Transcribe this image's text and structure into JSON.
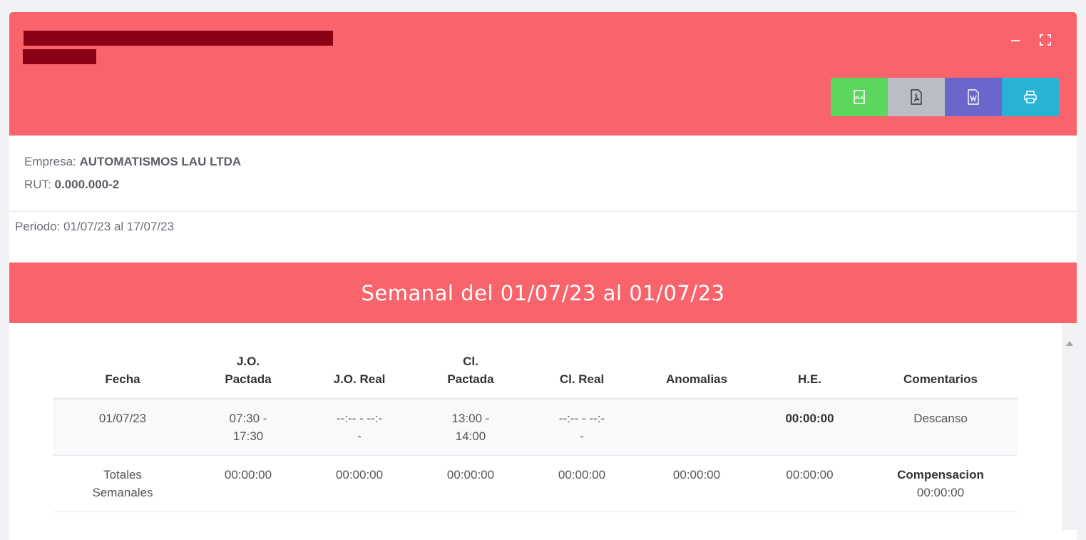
{
  "header": {
    "actions": {
      "xls_label": "XLS"
    },
    "colors": {
      "header_bg": "#f9636b",
      "redaction": "#8a0014"
    }
  },
  "info": {
    "empresa_label": "Empresa:",
    "empresa_value": "AUTOMATISMOS LAU LTDA",
    "rut_label": "RUT:",
    "rut_value": "0.000.000-2"
  },
  "periodo": "Periodo: 01/07/23 al 17/07/23",
  "section_title": "Semanal del 01/07/23 al 01/07/23",
  "table": {
    "headers": {
      "fecha": "Fecha",
      "jo_pactada_1": "J.O.",
      "jo_pactada_2": "Pactada",
      "jo_real": "J.O. Real",
      "cl_pactada_1": "Cl.",
      "cl_pactada_2": "Pactada",
      "cl_real": "Cl. Real",
      "anomalias": "Anomalias",
      "he": "H.E.",
      "comentarios": "Comentarios"
    },
    "rows": [
      {
        "fecha": "01/07/23",
        "jo_pactada_1": "07:30 -",
        "jo_pactada_2": "17:30",
        "jo_real_1": "--:-- - --:-",
        "jo_real_2": "-",
        "cl_pactada_1": "13:00 -",
        "cl_pactada_2": "14:00",
        "cl_real_1": "--:-- - --:-",
        "cl_real_2": "-",
        "anomalias": "",
        "he": "00:00:00",
        "comentarios": "Descanso"
      }
    ],
    "totals": {
      "label_1": "Totales",
      "label_2": "Semanales",
      "jo_pactada": "00:00:00",
      "jo_real": "00:00:00",
      "cl_pactada": "00:00:00",
      "cl_real": "00:00:00",
      "anomalias": "00:00:00",
      "he": "00:00:00",
      "compensacion_label": "Compensacion",
      "compensacion_value": "00:00:00"
    }
  }
}
